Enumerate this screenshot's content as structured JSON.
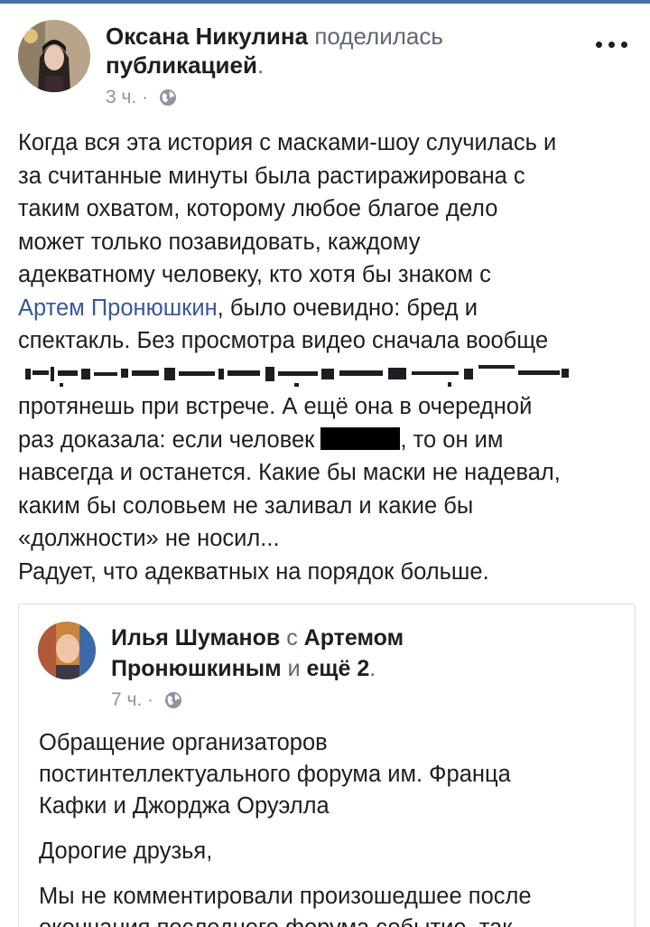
{
  "post": {
    "author": "Оксана Никулина",
    "action": "поделилась",
    "object": "публикацией",
    "punct": ".",
    "time": "3 ч.",
    "separator": " · ",
    "lines": {
      "l1": "Когда вся эта история с масками-шоу случилась и",
      "l2": "за считанные минуты была растиражирована с",
      "l3": "таким охватом, которому любое благое дело",
      "l4": "может только позавидовать, каждому",
      "l5": "адекватному человеку, кто хотя бы знаком с",
      "l6_mention": "Артем Пронюшкин",
      "l6_rest": ", было очевидно: бред и",
      "l7": "спектакль. Без просмотра видео сначала вообще",
      "l9": "протянешь при встрече. А ещё она в очередной",
      "l10_a": "раз доказала: если человек ",
      "l10_b": ", то он им",
      "l11": "навсегда и останется. Какие бы маски не надевал,",
      "l12": "каким бы соловьем не заливал и какие бы",
      "l13": "«должности» не носил...",
      "l14": "Радует, что адекватных на порядок больше."
    }
  },
  "shared": {
    "author": "Илья Шуманов",
    "with": " с ",
    "tagged": "Артемом",
    "tagged2": "Пронюшкиным",
    "and": " и ",
    "more": "ещё 2",
    "punct": ".",
    "time": "7 ч.",
    "separator": " · ",
    "title_l1": "Обращение организаторов",
    "title_l2": "постинтеллектуального форума им. Франца",
    "title_l3": "Кафки и Джорджа Оруэлла",
    "greeting": "Дорогие друзья,",
    "body_l1": "Мы не комментировали произошедшее после",
    "body_l2": "окончания последнего форума событие, так"
  },
  "icons": {
    "globe": "globe-icon",
    "more": "more-options-icon"
  },
  "colors": {
    "link": "#385898",
    "meta": "#90949c",
    "topbar": "#4a6ea9"
  }
}
